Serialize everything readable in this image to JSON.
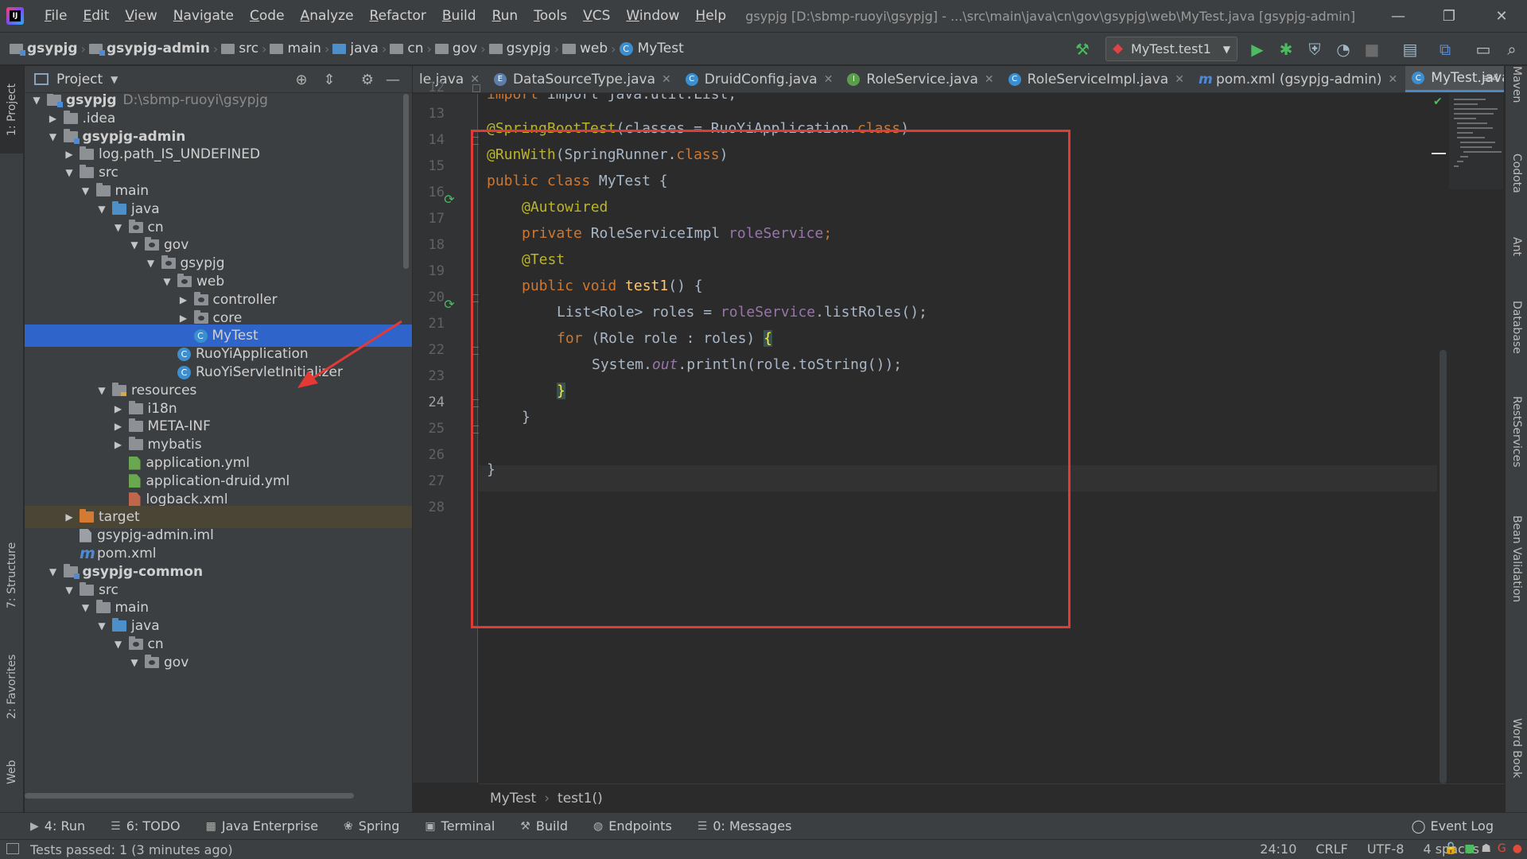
{
  "menu": {
    "logo": "IJ",
    "items": [
      "File",
      "Edit",
      "View",
      "Navigate",
      "Code",
      "Analyze",
      "Refactor",
      "Build",
      "Run",
      "Tools",
      "VCS",
      "Window",
      "Help"
    ],
    "window_title": "gsypjg [D:\\sbmp-ruoyi\\gsypjg] - ...\\src\\main\\java\\cn\\gov\\gsypjg\\web\\MyTest.java [gsypjg-admin]"
  },
  "window_controls": {
    "minimize": "—",
    "restore": "❐",
    "close": "✕"
  },
  "navbar": {
    "crumbs": [
      "gsypjg",
      "gsypjg-admin",
      "src",
      "main",
      "java",
      "cn",
      "gov",
      "gsypjg",
      "web",
      "MyTest"
    ],
    "run_config": "MyTest.test1"
  },
  "project_panel": {
    "title": "Project",
    "tree": [
      {
        "label": "gsypjg",
        "path": "D:\\sbmp-ruoyi\\gsypjg",
        "depth": 0,
        "arrow": "▼",
        "icon": "module",
        "bold": true
      },
      {
        "label": ".idea",
        "depth": 1,
        "arrow": "▶",
        "icon": "folder"
      },
      {
        "label": "gsypjg-admin",
        "depth": 1,
        "arrow": "▼",
        "icon": "module",
        "bold": true
      },
      {
        "label": "log.path_IS_UNDEFINED",
        "depth": 2,
        "arrow": "▶",
        "icon": "folder"
      },
      {
        "label": "src",
        "depth": 2,
        "arrow": "▼",
        "icon": "folder"
      },
      {
        "label": "main",
        "depth": 3,
        "arrow": "▼",
        "icon": "folder"
      },
      {
        "label": "java",
        "depth": 4,
        "arrow": "▼",
        "icon": "src"
      },
      {
        "label": "cn",
        "depth": 5,
        "arrow": "▼",
        "icon": "package"
      },
      {
        "label": "gov",
        "depth": 6,
        "arrow": "▼",
        "icon": "package"
      },
      {
        "label": "gsypjg",
        "depth": 7,
        "arrow": "▼",
        "icon": "package"
      },
      {
        "label": "web",
        "depth": 8,
        "arrow": "▼",
        "icon": "package"
      },
      {
        "label": "controller",
        "depth": 9,
        "arrow": "▶",
        "icon": "package"
      },
      {
        "label": "core",
        "depth": 9,
        "arrow": "▶",
        "icon": "package"
      },
      {
        "label": "MyTest",
        "depth": 9,
        "arrow": "",
        "icon": "class",
        "selected": true
      },
      {
        "label": "RuoYiApplication",
        "depth": 8,
        "arrow": "",
        "icon": "class"
      },
      {
        "label": "RuoYiServletInitializer",
        "depth": 8,
        "arrow": "",
        "icon": "class"
      },
      {
        "label": "resources",
        "depth": 4,
        "arrow": "▼",
        "icon": "res"
      },
      {
        "label": "i18n",
        "depth": 5,
        "arrow": "▶",
        "icon": "folder"
      },
      {
        "label": "META-INF",
        "depth": 5,
        "arrow": "▶",
        "icon": "folder"
      },
      {
        "label": "mybatis",
        "depth": 5,
        "arrow": "▶",
        "icon": "folder"
      },
      {
        "label": "application.yml",
        "depth": 5,
        "arrow": "",
        "icon": "yml"
      },
      {
        "label": "application-druid.yml",
        "depth": 5,
        "arrow": "",
        "icon": "yml"
      },
      {
        "label": "logback.xml",
        "depth": 5,
        "arrow": "",
        "icon": "xml"
      },
      {
        "label": "target",
        "depth": 2,
        "arrow": "▶",
        "icon": "target",
        "excluded": true
      },
      {
        "label": "gsypjg-admin.iml",
        "depth": 2,
        "arrow": "",
        "icon": "file"
      },
      {
        "label": "pom.xml",
        "depth": 2,
        "arrow": "",
        "icon": "maven"
      },
      {
        "label": "gsypjg-common",
        "depth": 1,
        "arrow": "▼",
        "icon": "module",
        "bold": true
      },
      {
        "label": "src",
        "depth": 2,
        "arrow": "▼",
        "icon": "folder"
      },
      {
        "label": "main",
        "depth": 3,
        "arrow": "▼",
        "icon": "folder"
      },
      {
        "label": "java",
        "depth": 4,
        "arrow": "▼",
        "icon": "src"
      },
      {
        "label": "cn",
        "depth": 5,
        "arrow": "▼",
        "icon": "package"
      },
      {
        "label": "gov",
        "depth": 6,
        "arrow": "▼",
        "icon": "package"
      }
    ]
  },
  "left_stripe": {
    "project": "1: Project",
    "structure": "7: Structure",
    "favorites": "2: Favorites",
    "web": "Web"
  },
  "right_stripe": {
    "maven": "Maven",
    "codota": "Codota",
    "ant": "Ant",
    "database": "Database",
    "rest": "RestServices",
    "bean": "Bean Validation",
    "word": "Word Book"
  },
  "editor_tabs": [
    {
      "label": "le.java",
      "icon": "",
      "color": ""
    },
    {
      "label": "DataSourceType.java",
      "icon": "E",
      "color": "#5d7ea8"
    },
    {
      "label": "DruidConfig.java",
      "icon": "C",
      "color": "#3b8fd0"
    },
    {
      "label": "RoleService.java",
      "icon": "I",
      "color": "#5a9e4b"
    },
    {
      "label": "RoleServiceImpl.java",
      "icon": "C",
      "color": "#3b8fd0"
    },
    {
      "label": "pom.xml (gsypjg-admin)",
      "icon": "m",
      "color": ""
    },
    {
      "label": "MyTest.java",
      "icon": "C",
      "color": "#3b8fd0",
      "active": true
    }
  ],
  "tabs_more": "≡4",
  "editor": {
    "lines": [
      12,
      13,
      14,
      15,
      16,
      17,
      18,
      19,
      20,
      21,
      22,
      23,
      24,
      25,
      26,
      27,
      28
    ],
    "current_line": 24,
    "code": {
      "l12": "import java.util.List;",
      "l14_ann": "@SpringBootTest",
      "l14_a": "(classes = RuoYiApplication.",
      "l14_kw": "class",
      "l14_b": ")",
      "l15_ann": "@RunWith",
      "l15_a": "(SpringRunner.",
      "l15_kw": "class",
      "l15_b": ")",
      "l16_kw": "public class ",
      "l16_a": "MyTest {",
      "l17_ann": "@Autowired",
      "l18_kw": "private ",
      "l18_a": "RoleServiceImpl ",
      "l18_fld": "roleService",
      "l18_b": ";",
      "l19_ann": "@Test",
      "l20_kw": "public void ",
      "l20_fn": "test1",
      "l20_a": "() {",
      "l21_a": "List<Role> roles = ",
      "l21_fld": "roleService",
      "l21_b": ".listRoles();",
      "l22_kw": "for ",
      "l22_a": "(Role role : roles) ",
      "l22_brace": "{",
      "l23_a": "System.",
      "l23_sta": "out",
      "l23_b": ".println(role.toString());",
      "l24_brace": "}",
      "l25_a": "}",
      "l27_a": "}"
    },
    "breadcrumbs": [
      "MyTest",
      "test1()"
    ]
  },
  "tool_windows": [
    {
      "icon": "▶",
      "label": "4: Run"
    },
    {
      "icon": "☰",
      "label": "6: TODO"
    },
    {
      "icon": "▦",
      "label": "Java Enterprise"
    },
    {
      "icon": "❀",
      "label": "Spring"
    },
    {
      "icon": "▣",
      "label": "Terminal"
    },
    {
      "icon": "⚒",
      "label": "Build"
    },
    {
      "icon": "◍",
      "label": "Endpoints"
    },
    {
      "icon": "☰",
      "label": "0: Messages"
    }
  ],
  "event_log": "Event Log",
  "status": {
    "message": "Tests passed: 1 (3 minutes ago)",
    "position": "24:10",
    "line_sep": "CRLF",
    "encoding": "UTF-8",
    "indent": "4 spaces"
  },
  "colors": {
    "accent": "#2f65ca",
    "highlight_box": "#e53935",
    "keyword": "#cc7832",
    "annotation": "#bbb529"
  }
}
